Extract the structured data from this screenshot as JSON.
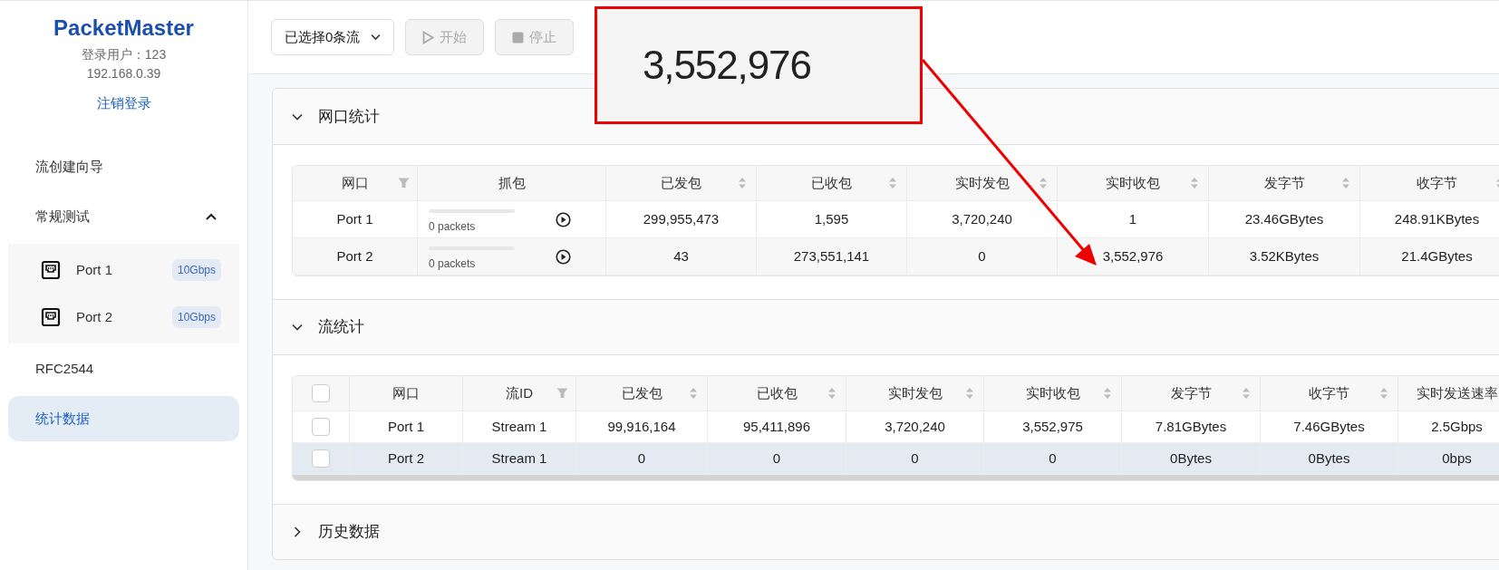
{
  "app": {
    "title": "PacketMaster",
    "user": "登录用户：123",
    "ip": "192.168.0.39",
    "logout": "注销登录"
  },
  "sidebar": {
    "items": [
      {
        "label": "流创建向导",
        "selected": false
      },
      {
        "label": "常规测试",
        "selected": false,
        "expanded": true,
        "children": [
          {
            "label": "Port 1",
            "badge": "10Gbps",
            "selected": false
          },
          {
            "label": "Port 2",
            "badge": "10Gbps",
            "selected": false
          }
        ]
      },
      {
        "label": "RFC2544",
        "selected": false
      },
      {
        "label": "统计数据",
        "selected": true
      }
    ]
  },
  "toolbar": {
    "stream_select": "已选择0条流",
    "buttons": [
      {
        "label": "开始",
        "kind": "start",
        "disabled": true
      },
      {
        "label": "停止",
        "kind": "stop",
        "disabled": true
      }
    ]
  },
  "sections": [
    {
      "title": "网口统计",
      "expanded": true,
      "table": {
        "kind": "ports",
        "columns": [
          {
            "label": "网口",
            "filter": true,
            "sortable": false
          },
          {
            "label": "抓包",
            "filter": false,
            "sortable": false
          },
          {
            "label": "已发包",
            "filter": false,
            "sortable": true
          },
          {
            "label": "已收包",
            "filter": false,
            "sortable": true
          },
          {
            "label": "实时发包",
            "filter": false,
            "sortable": true
          },
          {
            "label": "实时收包",
            "filter": false,
            "sortable": true
          },
          {
            "label": "发字节",
            "filter": false,
            "sortable": true
          },
          {
            "label": "收字节",
            "filter": false,
            "sortable": true
          }
        ],
        "rows": [
          {
            "highlighted": false,
            "cells": [
              "Port 1",
              {
                "level": 0,
                "text": "0 packets"
              },
              "299,955,473",
              "1,595",
              "3,720,240",
              "1",
              "23.46GBytes",
              "248.91KBytes"
            ]
          },
          {
            "highlighted": true,
            "cells": [
              "Port 2",
              {
                "level": 0,
                "text": "0 packets"
              },
              "43",
              "273,551,141",
              "0",
              "3,552,976",
              "3.52KBytes",
              "21.4GBytes"
            ]
          }
        ]
      }
    },
    {
      "title": "流统计",
      "expanded": true,
      "table": {
        "kind": "streams",
        "columns": [
          {
            "label": "网口",
            "filter": false,
            "sortable": false
          },
          {
            "label": "流ID",
            "filter": true,
            "sortable": false
          },
          {
            "label": "已发包",
            "filter": false,
            "sortable": true
          },
          {
            "label": "已收包",
            "filter": false,
            "sortable": true
          },
          {
            "label": "实时发包",
            "filter": false,
            "sortable": true
          },
          {
            "label": "实时收包",
            "filter": false,
            "sortable": true
          },
          {
            "label": "发字节",
            "filter": false,
            "sortable": true
          },
          {
            "label": "收字节",
            "filter": false,
            "sortable": true
          },
          {
            "label": "实时发送速率",
            "filter": false,
            "sortable": false
          }
        ],
        "header_checked": false,
        "rows": [
          {
            "highlighted": false,
            "checked": false,
            "cells": [
              "Port 1",
              "Stream 1",
              "99,916,164",
              "95,411,896",
              "3,720,240",
              "3,552,975",
              "7.81GBytes",
              "7.46GBytes",
              "2.5Gbps"
            ]
          },
          {
            "highlighted": true,
            "checked": false,
            "cells": [
              "Port 2",
              "Stream 1",
              "0",
              "0",
              "0",
              "0",
              "0Bytes",
              "0Bytes",
              "0bps"
            ]
          }
        ]
      }
    },
    {
      "title": "历史数据",
      "expanded": false
    }
  ],
  "annotation": {
    "text": "3,552,976"
  }
}
